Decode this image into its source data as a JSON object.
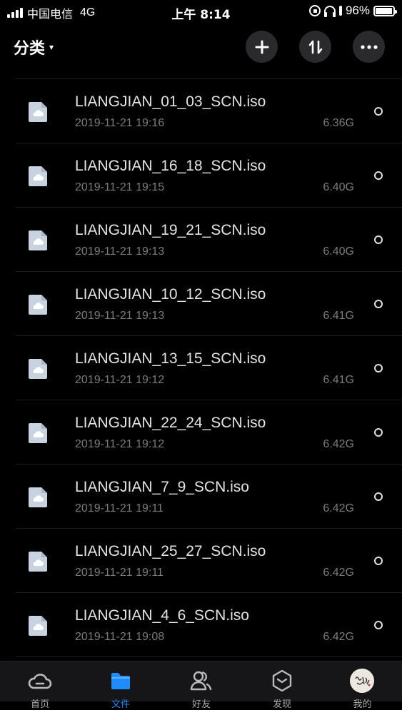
{
  "status_bar": {
    "carrier": "中国电信",
    "network": "4G",
    "time": "上午 8:14",
    "battery": "96%",
    "battery_level": 0.96
  },
  "header": {
    "title": "分类",
    "caret": "▾",
    "add_icon": "plus-icon",
    "sort_icon": "sort-icon",
    "more_icon": "more-icon"
  },
  "files": [
    {
      "name": "LIANGJIAN_01_03_SCN.iso",
      "date": "2019-11-21 19:16",
      "size": "6.36G"
    },
    {
      "name": "LIANGJIAN_16_18_SCN.iso",
      "date": "2019-11-21 19:15",
      "size": "6.40G"
    },
    {
      "name": "LIANGJIAN_19_21_SCN.iso",
      "date": "2019-11-21 19:13",
      "size": "6.40G"
    },
    {
      "name": "LIANGJIAN_10_12_SCN.iso",
      "date": "2019-11-21 19:13",
      "size": "6.41G"
    },
    {
      "name": "LIANGJIAN_13_15_SCN.iso",
      "date": "2019-11-21 19:12",
      "size": "6.41G"
    },
    {
      "name": "LIANGJIAN_22_24_SCN.iso",
      "date": "2019-11-21 19:12",
      "size": "6.42G"
    },
    {
      "name": "LIANGJIAN_7_9_SCN.iso",
      "date": "2019-11-21 19:11",
      "size": "6.42G"
    },
    {
      "name": "LIANGJIAN_25_27_SCN.iso",
      "date": "2019-11-21 19:11",
      "size": "6.42G"
    },
    {
      "name": "LIANGJIAN_4_6_SCN.iso",
      "date": "2019-11-21 19:08",
      "size": "6.42G"
    }
  ],
  "tabs": [
    {
      "label": "首页",
      "icon": "cloud-icon"
    },
    {
      "label": "文件",
      "icon": "folder-icon",
      "active": true
    },
    {
      "label": "好友",
      "icon": "friends-icon"
    },
    {
      "label": "发现",
      "icon": "discover-icon"
    },
    {
      "label": "我的",
      "icon": "avatar"
    }
  ],
  "colors": {
    "background": "#000000",
    "accent": "#1f8bff",
    "file_icon": "#c8d3df"
  }
}
